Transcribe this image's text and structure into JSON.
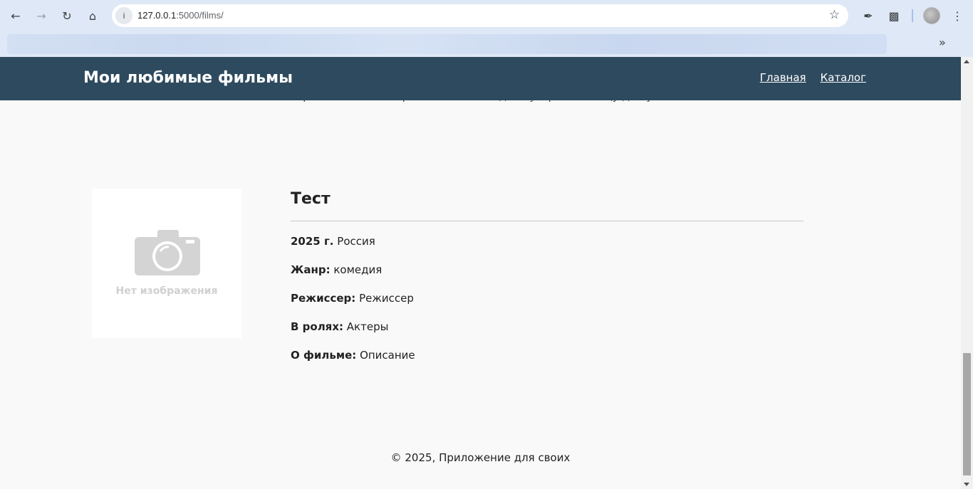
{
  "browser": {
    "url_host": "127.0.0.1",
    "url_path": ":5000/films/"
  },
  "site": {
    "title": "Мои любимые фильмы",
    "nav": [
      "Главная",
      "Каталог"
    ]
  },
  "previous_item_fragment": "скрытые мотивы персонажей и ненадежную рассказчицу для усложнения.",
  "film": {
    "title": "Тест",
    "no_image": "Нет изображения",
    "year_label": "2025 г.",
    "country": "Россия",
    "genre_label": "Жанр:",
    "genre": "комедия",
    "director_label": "Режиссер:",
    "director": "Режиссер",
    "cast_label": "В ролях:",
    "cast": "Актеры",
    "about_label": "О фильме:",
    "about": "Описание"
  },
  "footer": "© 2025, Приложение для своих"
}
